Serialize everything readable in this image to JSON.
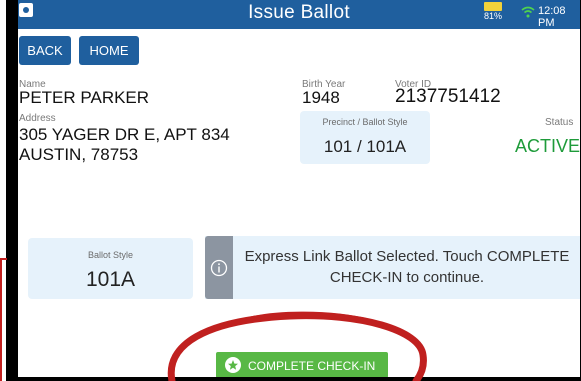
{
  "header": {
    "title": "Issue Ballot",
    "battery": "81%",
    "time": "12:08 PM"
  },
  "nav": {
    "back_label": "BACK",
    "home_label": "HOME"
  },
  "voter": {
    "name_label": "Name",
    "name": "PETER PARKER",
    "address_label": "Address",
    "address_line1": "305 YAGER DR E, APT 834",
    "address_line2": "AUSTIN, 78753",
    "birth_year_label": "Birth Year",
    "birth_year": "1948",
    "voter_id_label": "Voter ID",
    "voter_id": "2137751412",
    "precinct_label": "Precinct / Ballot Style",
    "precinct": "101 / 101A",
    "status_label": "Status",
    "status": "ACTIVE"
  },
  "ballot": {
    "style_label": "Ballot Style",
    "style": "101A",
    "message": "Express Link Ballot Selected. Touch COMPLETE CHECK-IN to continue."
  },
  "actions": {
    "complete_label": "COMPLETE CHECK-IN"
  },
  "colors": {
    "header": "#1f5f9e",
    "status_active": "#1e9b3a",
    "complete_button": "#58b845",
    "card_bg": "#e6f2fb",
    "annotation": "#c0201f"
  }
}
